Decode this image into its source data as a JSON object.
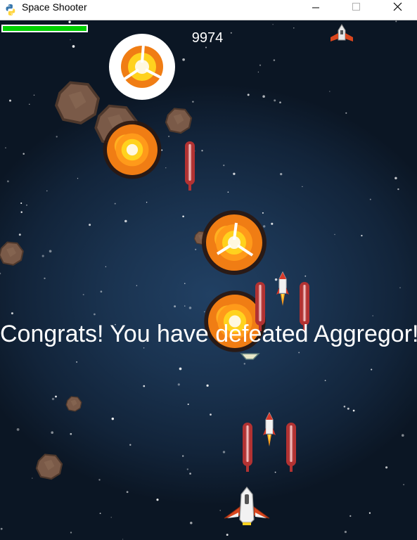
{
  "window": {
    "title": "Space Shooter",
    "app_icon": "python-icon",
    "controls": [
      "minimize-icon",
      "maximize-icon",
      "close-icon"
    ]
  },
  "hud": {
    "score": "9974",
    "health_fraction": 1.0,
    "health_color": "#00d000"
  },
  "message": "Congrats! You have defeated Aggregor!",
  "colors": {
    "background": "#1a3350",
    "laser": "#c23a3a",
    "ship_body": "#e8e8e8",
    "ship_wing": "#d9461e",
    "explosion_orange": "#f07d14",
    "explosion_yellow": "#ffd21e",
    "asteroid": "#7a5a48"
  },
  "icons": [
    "player-ship-icon",
    "enemy-ship-icon",
    "missile-icon",
    "laser-bolt-icon",
    "asteroid-icon",
    "explosion-icon"
  ]
}
